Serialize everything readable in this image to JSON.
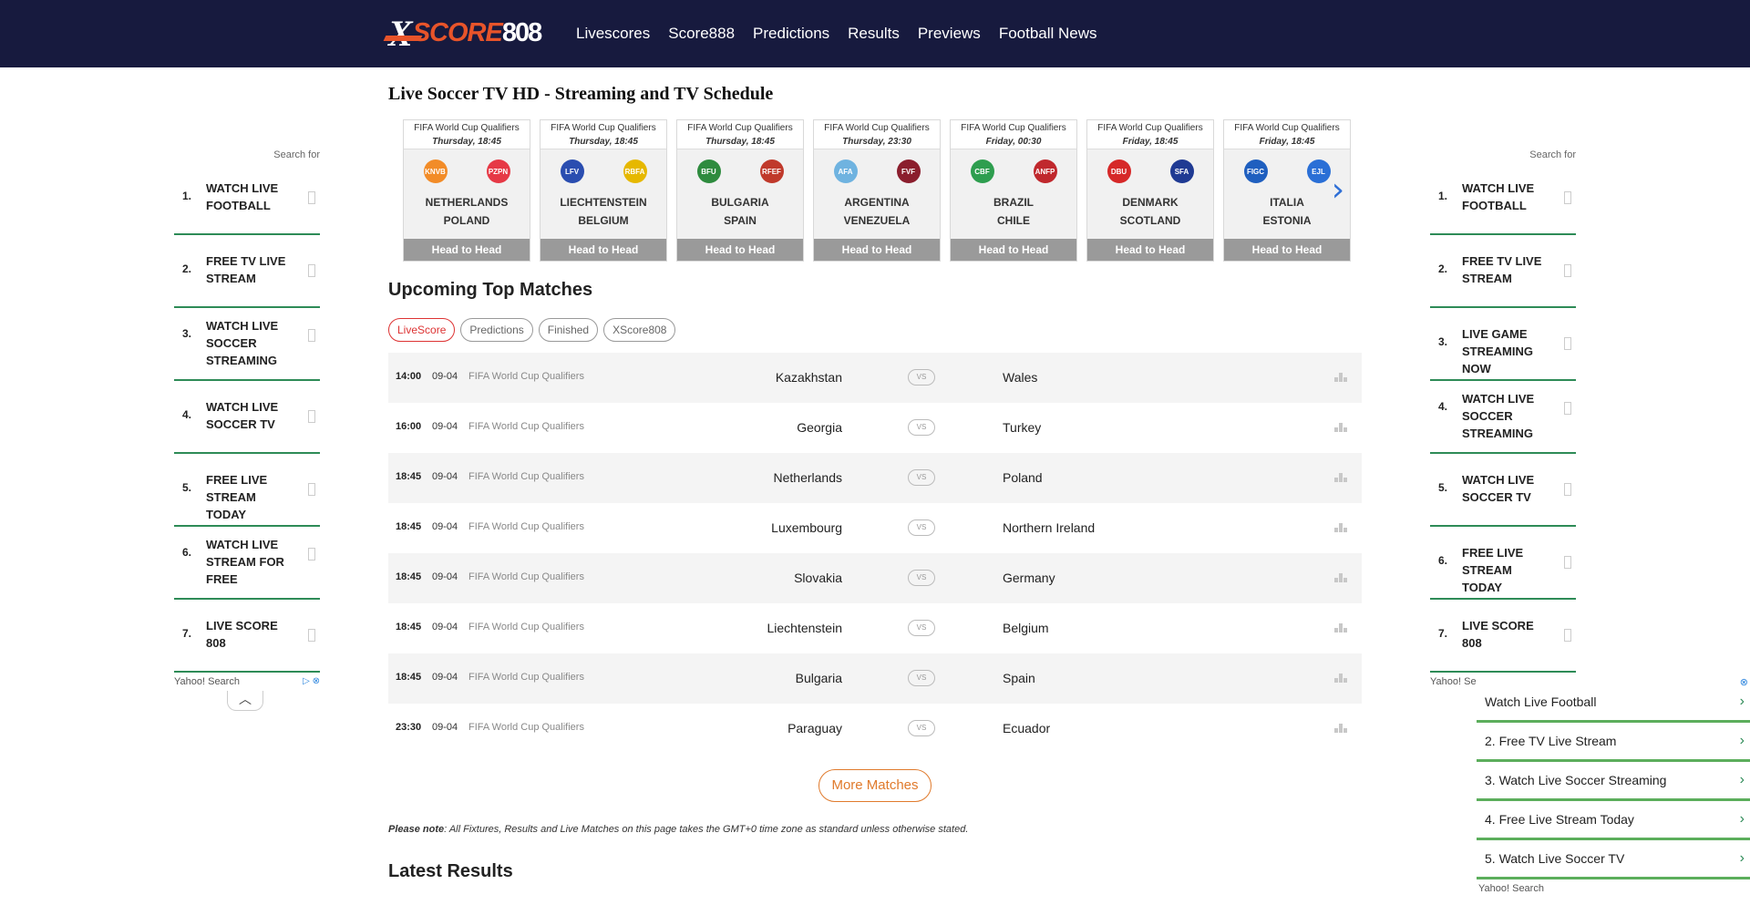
{
  "logo": {
    "x": "X",
    "score": "SCORE",
    "num": "808"
  },
  "nav": [
    "Livescores",
    "Score888",
    "Predictions",
    "Results",
    "Previews",
    "Football News"
  ],
  "page_title": "Live Soccer TV HD - Streaming and TV Schedule",
  "carousel": [
    {
      "comp": "FIFA World Cup Qualifiers",
      "time": "Thursday, 18:45",
      "home": "NETHERLANDS",
      "away": "POLAND",
      "h2h": "Head to Head",
      "c1": "#f28c28",
      "c2": "#e63946",
      "a1": "KNVB",
      "a2": "PZPN"
    },
    {
      "comp": "FIFA World Cup Qualifiers",
      "time": "Thursday, 18:45",
      "home": "LIECHTENSTEIN",
      "away": "BELGIUM",
      "h2h": "Head to Head",
      "c1": "#2a4db0",
      "c2": "#e6b800",
      "a1": "LFV",
      "a2": "RBFA"
    },
    {
      "comp": "FIFA World Cup Qualifiers",
      "time": "Thursday, 18:45",
      "home": "BULGARIA",
      "away": "SPAIN",
      "h2h": "Head to Head",
      "c1": "#2e8b3e",
      "c2": "#c0392b",
      "a1": "BFU",
      "a2": "RFEF"
    },
    {
      "comp": "FIFA World Cup Qualifiers",
      "time": "Thursday, 23:30",
      "home": "ARGENTINA",
      "away": "VENEZUELA",
      "h2h": "Head to Head",
      "c1": "#6fb3e0",
      "c2": "#8b1e2d",
      "a1": "AFA",
      "a2": "FVF"
    },
    {
      "comp": "FIFA World Cup Qualifiers",
      "time": "Friday, 00:30",
      "home": "BRAZIL",
      "away": "CHILE",
      "h2h": "Head to Head",
      "c1": "#2e9e4f",
      "c2": "#c0282d",
      "a1": "CBF",
      "a2": "ANFP"
    },
    {
      "comp": "FIFA World Cup Qualifiers",
      "time": "Friday, 18:45",
      "home": "DENMARK",
      "away": "SCOTLAND",
      "h2h": "Head to Head",
      "c1": "#d62828",
      "c2": "#1f3a93",
      "a1": "DBU",
      "a2": "SFA"
    },
    {
      "comp": "FIFA World Cup Qualifiers",
      "time": "Friday, 18:45",
      "home": "ITALIA",
      "away": "ESTONIA",
      "h2h": "Head to Head",
      "c1": "#1f5fbf",
      "c2": "#2a6fd6",
      "a1": "FIGC",
      "a2": "EJL"
    }
  ],
  "upcoming_title": "Upcoming Top Matches",
  "filters": [
    "LiveScore",
    "Predictions",
    "Finished",
    "XScore808"
  ],
  "matches": [
    {
      "time": "14:00",
      "date": "09-04",
      "comp": "FIFA World Cup Qualifiers",
      "home": "Kazakhstan",
      "away": "Wales"
    },
    {
      "time": "16:00",
      "date": "09-04",
      "comp": "FIFA World Cup Qualifiers",
      "home": "Georgia",
      "away": "Turkey"
    },
    {
      "time": "18:45",
      "date": "09-04",
      "comp": "FIFA World Cup Qualifiers",
      "home": "Netherlands",
      "away": "Poland"
    },
    {
      "time": "18:45",
      "date": "09-04",
      "comp": "FIFA World Cup Qualifiers",
      "home": "Luxembourg",
      "away": "Northern Ireland"
    },
    {
      "time": "18:45",
      "date": "09-04",
      "comp": "FIFA World Cup Qualifiers",
      "home": "Slovakia",
      "away": "Germany"
    },
    {
      "time": "18:45",
      "date": "09-04",
      "comp": "FIFA World Cup Qualifiers",
      "home": "Liechtenstein",
      "away": "Belgium"
    },
    {
      "time": "18:45",
      "date": "09-04",
      "comp": "FIFA World Cup Qualifiers",
      "home": "Bulgaria",
      "away": "Spain"
    },
    {
      "time": "23:30",
      "date": "09-04",
      "comp": "FIFA World Cup Qualifiers",
      "home": "Paraguay",
      "away": "Ecuador"
    }
  ],
  "vs_label": "VS",
  "more_label": "More Matches",
  "note": {
    "bold": "Please note",
    "text": ": All Fixtures, Results and Live Matches on this page takes the GMT+0 time zone as standard unless otherwise stated."
  },
  "latest_title": "Latest Results",
  "left_side": {
    "search_for": "Search for",
    "items": [
      {
        "n": "1.",
        "label": "WATCH LIVE FOOTBALL"
      },
      {
        "n": "2.",
        "label": "FREE TV LIVE STREAM"
      },
      {
        "n": "3.",
        "label": "WATCH LIVE SOCCER STREAMING"
      },
      {
        "n": "4.",
        "label": "WATCH LIVE SOCCER TV"
      },
      {
        "n": "5.",
        "label": "FREE LIVE STREAM TODAY"
      },
      {
        "n": "6.",
        "label": "WATCH LIVE STREAM FOR FREE"
      },
      {
        "n": "7.",
        "label": "LIVE SCORE 808"
      }
    ],
    "footer": "Yahoo! Search"
  },
  "right_side": {
    "search_for": "Search for",
    "items": [
      {
        "n": "1.",
        "label": "WATCH LIVE FOOTBALL"
      },
      {
        "n": "2.",
        "label": "FREE TV LIVE STREAM"
      },
      {
        "n": "3.",
        "label": "LIVE GAME STREAMING NOW"
      },
      {
        "n": "4.",
        "label": "WATCH LIVE SOCCER STREAMING"
      },
      {
        "n": "5.",
        "label": "WATCH LIVE SOCCER TV"
      },
      {
        "n": "6.",
        "label": "FREE LIVE STREAM TODAY"
      },
      {
        "n": "7.",
        "label": "LIVE SCORE 808"
      }
    ],
    "footer": "Yahoo! Search"
  },
  "yahoo_box": {
    "rows": [
      {
        "text": "Watch Live Football"
      },
      {
        "text": "2.  Free TV Live Stream"
      },
      {
        "text": "3.  Watch Live Soccer Streaming"
      },
      {
        "text": "4.  Free Live Stream Today"
      },
      {
        "text": "5.  Watch Live Soccer TV"
      }
    ],
    "footer": "Yahoo! Search"
  },
  "colors": {
    "header": "#171a3e",
    "accent_orange": "#e8542a",
    "divider_green": "#2e8b57"
  }
}
